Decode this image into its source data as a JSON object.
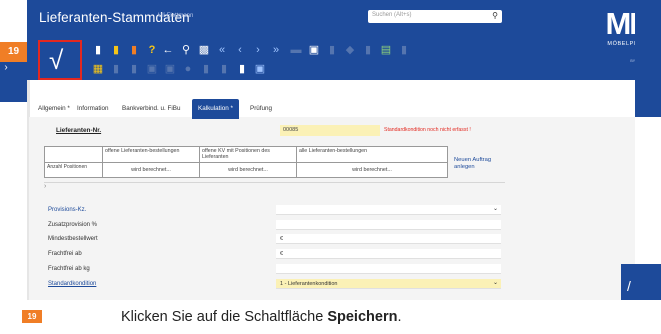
{
  "header": {
    "title": "Lieferanten-Stammdaten",
    "user": "Uli Flottmann",
    "search_placeholder": "Suchen (Alt+s)",
    "logo_mark": "MP.",
    "logo_sub": "MÖBELPILOT",
    "logo_tiny": "BY MAWA/ACH"
  },
  "step": {
    "number": "19"
  },
  "toolbar": {
    "save_symbol": "√",
    "icons": [
      "new-doc-icon",
      "copy-doc-icon",
      "delete-icon",
      "help-icon",
      "undo-icon",
      "search-icon",
      "print-icon",
      "first-icon",
      "prev-icon",
      "next-icon",
      "last-icon"
    ]
  },
  "tabs": [
    {
      "label": "Allgemein *"
    },
    {
      "label": "Information"
    },
    {
      "label": "Bankverbind. u. FiBu"
    },
    {
      "label": "Kalkulation *",
      "active": true
    },
    {
      "label": "Prüfung"
    }
  ],
  "form": {
    "lieferanten_nr_label": "Lieferanten-Nr.",
    "lieferanten_nr_value": "00085",
    "lieferanten_warning": "Standardkondition noch nicht erfasst !",
    "grid": {
      "headers": [
        "",
        "offene Lieferanten-bestellungen",
        "offene KV mit Positionen des Lieferanten",
        "alle Lieferanten-bestellungen"
      ],
      "row_label": "Anzahl Positionen",
      "cells": [
        "wird berechnet...",
        "wird berechnet...",
        "wird berechnet..."
      ]
    },
    "new_order_link": "Neuen Auftrag anlegen",
    "rows": [
      {
        "label": "Provisions-Kz.",
        "value": "",
        "style": "blue",
        "dropdown": true
      },
      {
        "label": "Zusatzprovision %",
        "value": ""
      },
      {
        "label": "Mindestbestellwert",
        "value": "€"
      },
      {
        "label": "Frachtfrei ab",
        "value": "€"
      },
      {
        "label": "Frachtfrei ab kg",
        "value": ""
      },
      {
        "label": "Standardkondition",
        "value": "1 - Lieferantenkondition",
        "style": "blue-underline",
        "dropdown": true,
        "highlight": true
      }
    ]
  },
  "instruction": {
    "step": "19",
    "text": "Klicken Sie auf die Schaltfläche ",
    "emphasis": "Speichern",
    "end": "."
  },
  "colors": {
    "brand_blue": "#1d4a9a",
    "accent_orange": "#f07e26",
    "highlight_red": "#e3281f",
    "field_yellow": "#fbf1b6"
  }
}
